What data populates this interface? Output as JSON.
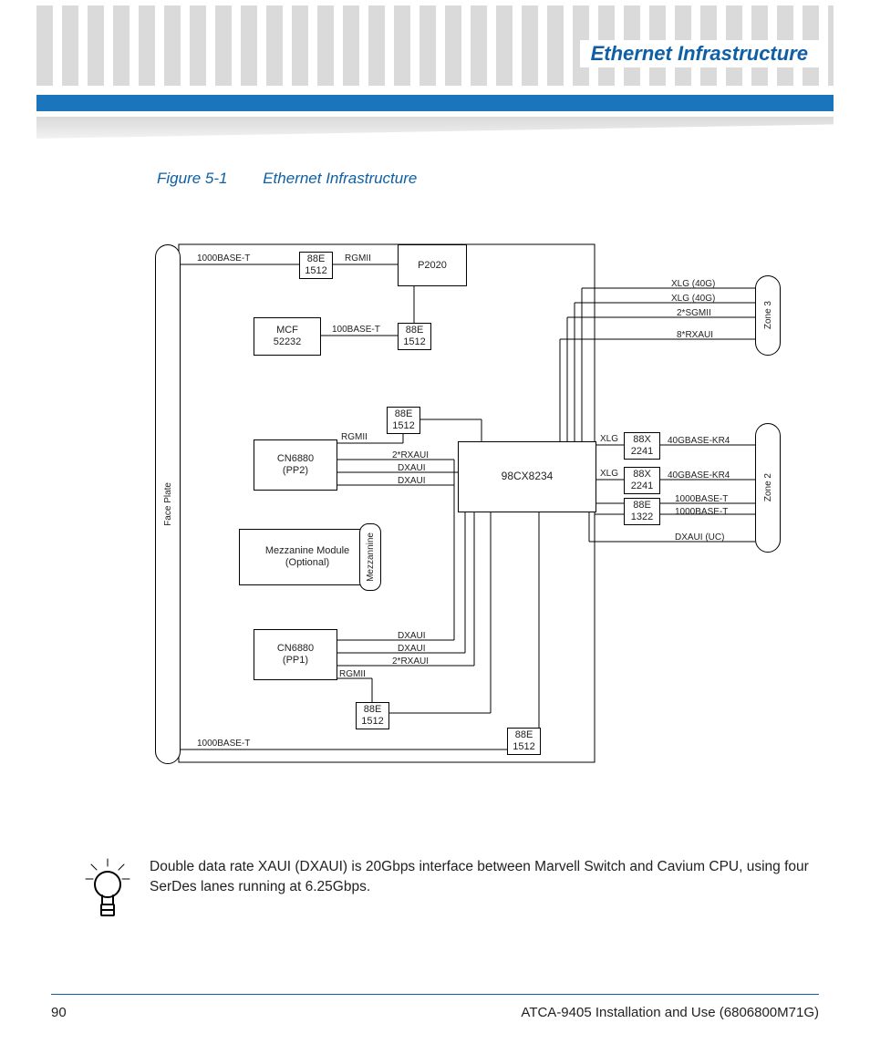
{
  "header": {
    "title": "Ethernet Infrastructure"
  },
  "figure": {
    "label": "Figure 5-1",
    "title": "Ethernet Infrastructure"
  },
  "diagram": {
    "blocks": {
      "face_plate": "Face Plate",
      "p2020": "P2020",
      "mcf": "MCF\n52232",
      "cn6880_pp2": "CN6880\n(PP2)",
      "cn6880_pp1": "CN6880\n(PP1)",
      "mezz_module": "Mezzanine Module\n(Optional)",
      "mezzanine_tab": "Mezzannine",
      "switch": "98CX8234",
      "zone3": "Zone 3",
      "zone2": "Zone 2",
      "e1512_a": "88E\n1512",
      "e1512_b": "88E\n1512",
      "e1512_c": "88E\n1512",
      "e1512_d": "88E\n1512",
      "e1512_e": "88E\n1512",
      "x2241_a": "88X\n2241",
      "x2241_b": "88X\n2241",
      "e1322": "88E\n1322"
    },
    "labels": {
      "l1000bt_top": "1000BASE-T",
      "l1000bt_bot": "1000BASE-T",
      "rgmii_top": "RGMII",
      "l100bt": "100BASE-T",
      "rgmii_pp2": "RGMII",
      "rgmii_pp1": "RGMII",
      "tworx_pp2": "2*RXAUI",
      "dxaui_pp2a": "DXAUI",
      "dxaui_pp2b": "DXAUI",
      "dxaui_pp1a": "DXAUI",
      "dxaui_pp1b": "DXAUI",
      "tworx_pp1": "2*RXAUI",
      "xlg_a": "XLG",
      "xlg_b": "XLG",
      "z3_xlg1": "XLG (40G)",
      "z3_xlg2": "XLG (40G)",
      "z3_sgmii": "2*SGMII",
      "z3_rxaui": "8*RXAUI",
      "z2_kr4_a": "40GBASE-KR4",
      "z2_kr4_b": "40GBASE-KR4",
      "z2_1000a": "1000BASE-T",
      "z2_1000b": "1000BASE-T",
      "z2_dxaui": "DXAUI (UC)"
    }
  },
  "tip": {
    "text": "Double data rate XAUI (DXAUI) is 20Gbps interface between Marvell Switch and Cavium CPU, using four SerDes lanes running at 6.25Gbps."
  },
  "footer": {
    "page": "90",
    "doc": "ATCA-9405 Installation and Use (6806800M71G)"
  }
}
